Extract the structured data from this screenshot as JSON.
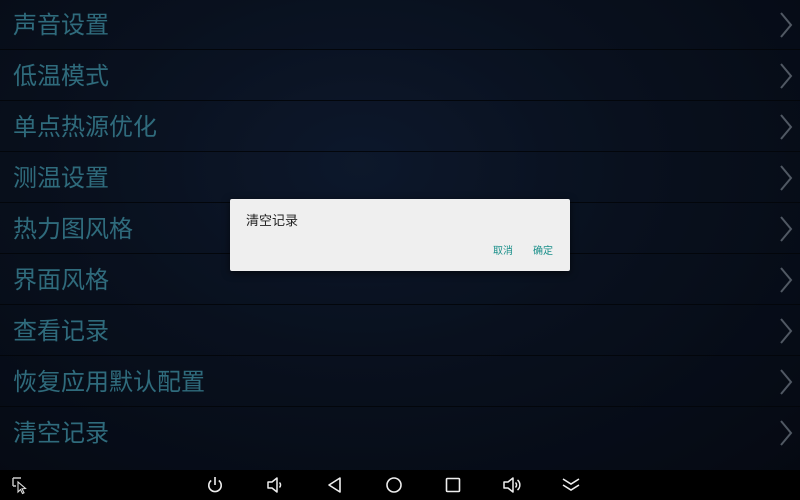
{
  "menu": {
    "items": [
      {
        "label": "声音设置",
        "icon": "chevron-right-icon"
      },
      {
        "label": "低温模式",
        "icon": "chevron-right-icon"
      },
      {
        "label": "单点热源优化",
        "icon": "chevron-right-icon"
      },
      {
        "label": "测温设置",
        "icon": "chevron-right-icon"
      },
      {
        "label": "热力图风格",
        "icon": "chevron-right-icon"
      },
      {
        "label": "界面风格",
        "icon": "chevron-right-icon"
      },
      {
        "label": "查看记录",
        "icon": "chevron-right-icon"
      },
      {
        "label": "恢复应用默认配置",
        "icon": "chevron-right-icon"
      },
      {
        "label": "清空记录",
        "icon": "chevron-right-icon"
      }
    ]
  },
  "dialog": {
    "message": "清空记录",
    "cancel_label": "取消",
    "ok_label": "确定"
  },
  "navbar": {
    "icons": [
      "screenshot-icon",
      "power-icon",
      "volume-down-icon",
      "back-icon",
      "home-icon",
      "recents-icon",
      "volume-up-icon",
      "hide-bar-icon"
    ]
  },
  "colors": {
    "menu_text": "#3f8fa6",
    "background": "#0c1628",
    "dialog_bg": "#efefef",
    "dialog_button": "#1a8f8a"
  }
}
